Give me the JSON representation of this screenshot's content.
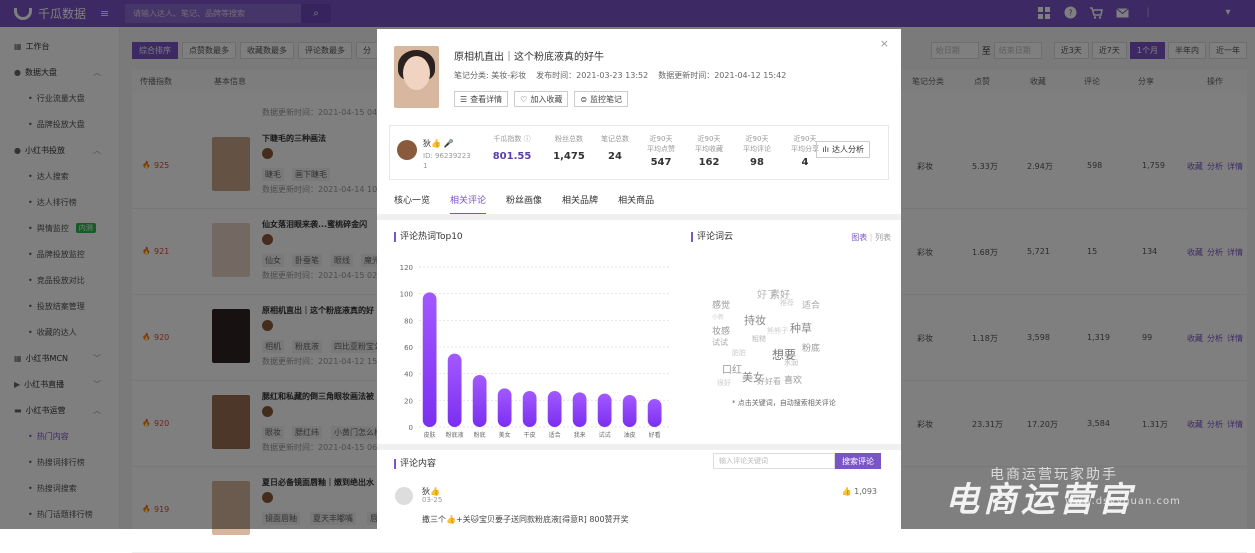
{
  "topbar": {
    "app_name": "千瓜数据",
    "menu_icon": "≡",
    "search_placeholder": "请输入达人、笔记、品牌等搜索",
    "search_icon": "⌕"
  },
  "sidebar": {
    "items": [
      {
        "label": "工作台",
        "icon": "▦"
      },
      {
        "label": "数据大盘",
        "icon": "●",
        "chev": "︿"
      },
      {
        "label": "行业流量大盘",
        "sub": true
      },
      {
        "label": "品牌投放大盘",
        "sub": true
      },
      {
        "label": "小红书投放",
        "icon": "●",
        "chev": "︿"
      },
      {
        "label": "达人搜索",
        "sub": true
      },
      {
        "label": "达人排行榜",
        "sub": true
      },
      {
        "label": "舆情监控",
        "sub": true,
        "badge": "内测"
      },
      {
        "label": "品牌投放监控",
        "sub": true
      },
      {
        "label": "竞品投放对比",
        "sub": true
      },
      {
        "label": "投放结案管理",
        "sub": true
      },
      {
        "label": "收藏的达人",
        "sub": true
      },
      {
        "label": "小红书MCN",
        "icon": "▦",
        "chev": "﹀"
      },
      {
        "label": "小红书直播",
        "icon": "▶",
        "chev": "﹀"
      },
      {
        "label": "小红书运营",
        "icon": "▬",
        "chev": "︿"
      },
      {
        "label": "热门内容",
        "sub": true,
        "active": true
      },
      {
        "label": "热搜词排行榜",
        "sub": true
      },
      {
        "label": "热搜词搜索",
        "sub": true
      },
      {
        "label": "热门话题排行榜",
        "sub": true
      }
    ]
  },
  "filters": [
    "综合排序",
    "点赞数最多",
    "收藏数最多",
    "评论数最多",
    "分"
  ],
  "range": {
    "start_placeholder": "始日期",
    "to": "至",
    "end_placeholder": "结束日期",
    "options": [
      "近3天",
      "近7天",
      "1个月",
      "半年内",
      "近一年"
    ],
    "selected": "1个月"
  },
  "table": {
    "headers": [
      "传播指数",
      "基本信息",
      "笔记分类",
      "点赞",
      "收藏",
      "评论",
      "分享",
      "操作"
    ],
    "top_fragment": "数据更新时间：2021-04-15 04",
    "rows": [
      {
        "score": "925",
        "title": "下睫毛的三种画法",
        "tags": [
          "睫毛",
          "画下睫毛"
        ],
        "updated": "数据更新时间：2021-04-14 10",
        "category": "彩妆",
        "likes": "5.33万",
        "favs": "2.94万",
        "comments": "598",
        "shares": "1,759"
      },
      {
        "score": "921",
        "title": "仙女落泪眼来袭...蜜桃碎金闪",
        "tags": [
          "仙女",
          "卧蚕笔",
          "眼线",
          "魔光"
        ],
        "updated": "数据更新时间：2021-04-15 02",
        "category": "彩妆",
        "likes": "1.68万",
        "favs": "5,721",
        "comments": "15",
        "shares": "134"
      },
      {
        "score": "920",
        "title": "原相机直出｜这个粉底液真的好",
        "tags": [
          "相机",
          "粉底液",
          "四比亚粉宝公"
        ],
        "updated": "数据更新时间：2021-04-12 15",
        "category": "彩妆",
        "likes": "1.18万",
        "favs": "3,598",
        "comments": "1,319",
        "shares": "99"
      },
      {
        "score": "920",
        "title": "腮红和私藏的倒三角眼妆画法被",
        "tags": [
          "眼妆",
          "腮红纬",
          "小黄门怎么样"
        ],
        "updated": "数据更新时间：2021-04-15 06",
        "category": "彩妆",
        "likes": "23.31万",
        "favs": "17.20万",
        "comments": "3,584",
        "shares": "1.31万"
      },
      {
        "score": "919",
        "title": "夏日必备镜面唇釉｜嫩到绝出水",
        "tags": [
          "镜面唇釉",
          "夏天丰嘟嘴",
          "唇釉"
        ],
        "updated": "",
        "category": "",
        "likes": "",
        "favs": "",
        "comments": "",
        "shares": ""
      }
    ],
    "ops": [
      "收藏",
      "分析",
      "详情"
    ]
  },
  "modal": {
    "close": "×",
    "title": "原相机直出｜这个粉底液真的好牛",
    "category": "笔记分类: 美妆-彩妆",
    "published": "发布时间：2021-03-23 13:52",
    "updated": "数据更新时间：2021-04-12 15:42",
    "buttons": {
      "detail": "查看详情",
      "favorite": "加入收藏",
      "monitor": "监控笔记"
    },
    "author": {
      "name": "狄👍 🎤",
      "id_label": "ID: 96239223 1"
    },
    "stats": [
      {
        "label": "千瓜指数 ⓘ",
        "value": "801.55"
      },
      {
        "label": "粉丝总数",
        "value": "1,475"
      },
      {
        "label": "笔记总数",
        "value": "24"
      },
      {
        "label": "近90天\n平均点赞",
        "value": "547"
      },
      {
        "label": "近90天\n平均收藏",
        "value": "162"
      },
      {
        "label": "近90天\n平均评论",
        "value": "98"
      },
      {
        "label": "近90天\n平均分享",
        "value": "4"
      }
    ],
    "analysis_btn": "达人分析",
    "tabs": [
      "核心一览",
      "相关评论",
      "粉丝画像",
      "相关品牌",
      "相关商品"
    ],
    "active_tab": "相关评论",
    "hot_title": "评论热词Top10",
    "cloud_title": "评论词云",
    "cloud_tabs": {
      "chart": "图表",
      "divider": "|",
      "list": "列表"
    },
    "cloud_words": [
      "好了",
      "素好",
      "感觉",
      "适合",
      "推荐",
      "小新",
      "持妆",
      "妆感",
      "种草",
      "试试",
      "想要",
      "粉底",
      "脏脏",
      "口红",
      "美女",
      "好好看",
      "喜欢",
      "很好",
      "水润",
      "熊熊子",
      "粗糙"
    ],
    "cloud_hint": "* 点击关键词，自动搜索相关评论",
    "comments_title": "评论内容",
    "comment_search_placeholder": "输入评论关键词",
    "comment_search_btn": "搜索评论",
    "comment": {
      "name": "狄👍",
      "date": "03-25",
      "likes": "👍 1,093",
      "text": "撒三个👍+关🐱宝贝要子送同款粉底液[得意R] 800赞开奖"
    }
  },
  "watermark": {
    "text": "电商运营官",
    "small": "电商运营玩家助手",
    "url": "www.dsyyguan.com"
  },
  "chart_data": {
    "type": "bar",
    "title": "评论热词Top10",
    "categories": [
      "皮肤",
      "粉底液",
      "粉底",
      "美女",
      "干皮",
      "适合",
      "我来",
      "试试",
      "油皮",
      "好看"
    ],
    "values": [
      101,
      55,
      39,
      29,
      27,
      27,
      26,
      25,
      24,
      21
    ],
    "ylim": [
      0,
      120
    ],
    "yticks": [
      0,
      20,
      40,
      60,
      80,
      100,
      120
    ],
    "color_top": "#a259ff",
    "color_bottom": "#7b2ff0"
  }
}
